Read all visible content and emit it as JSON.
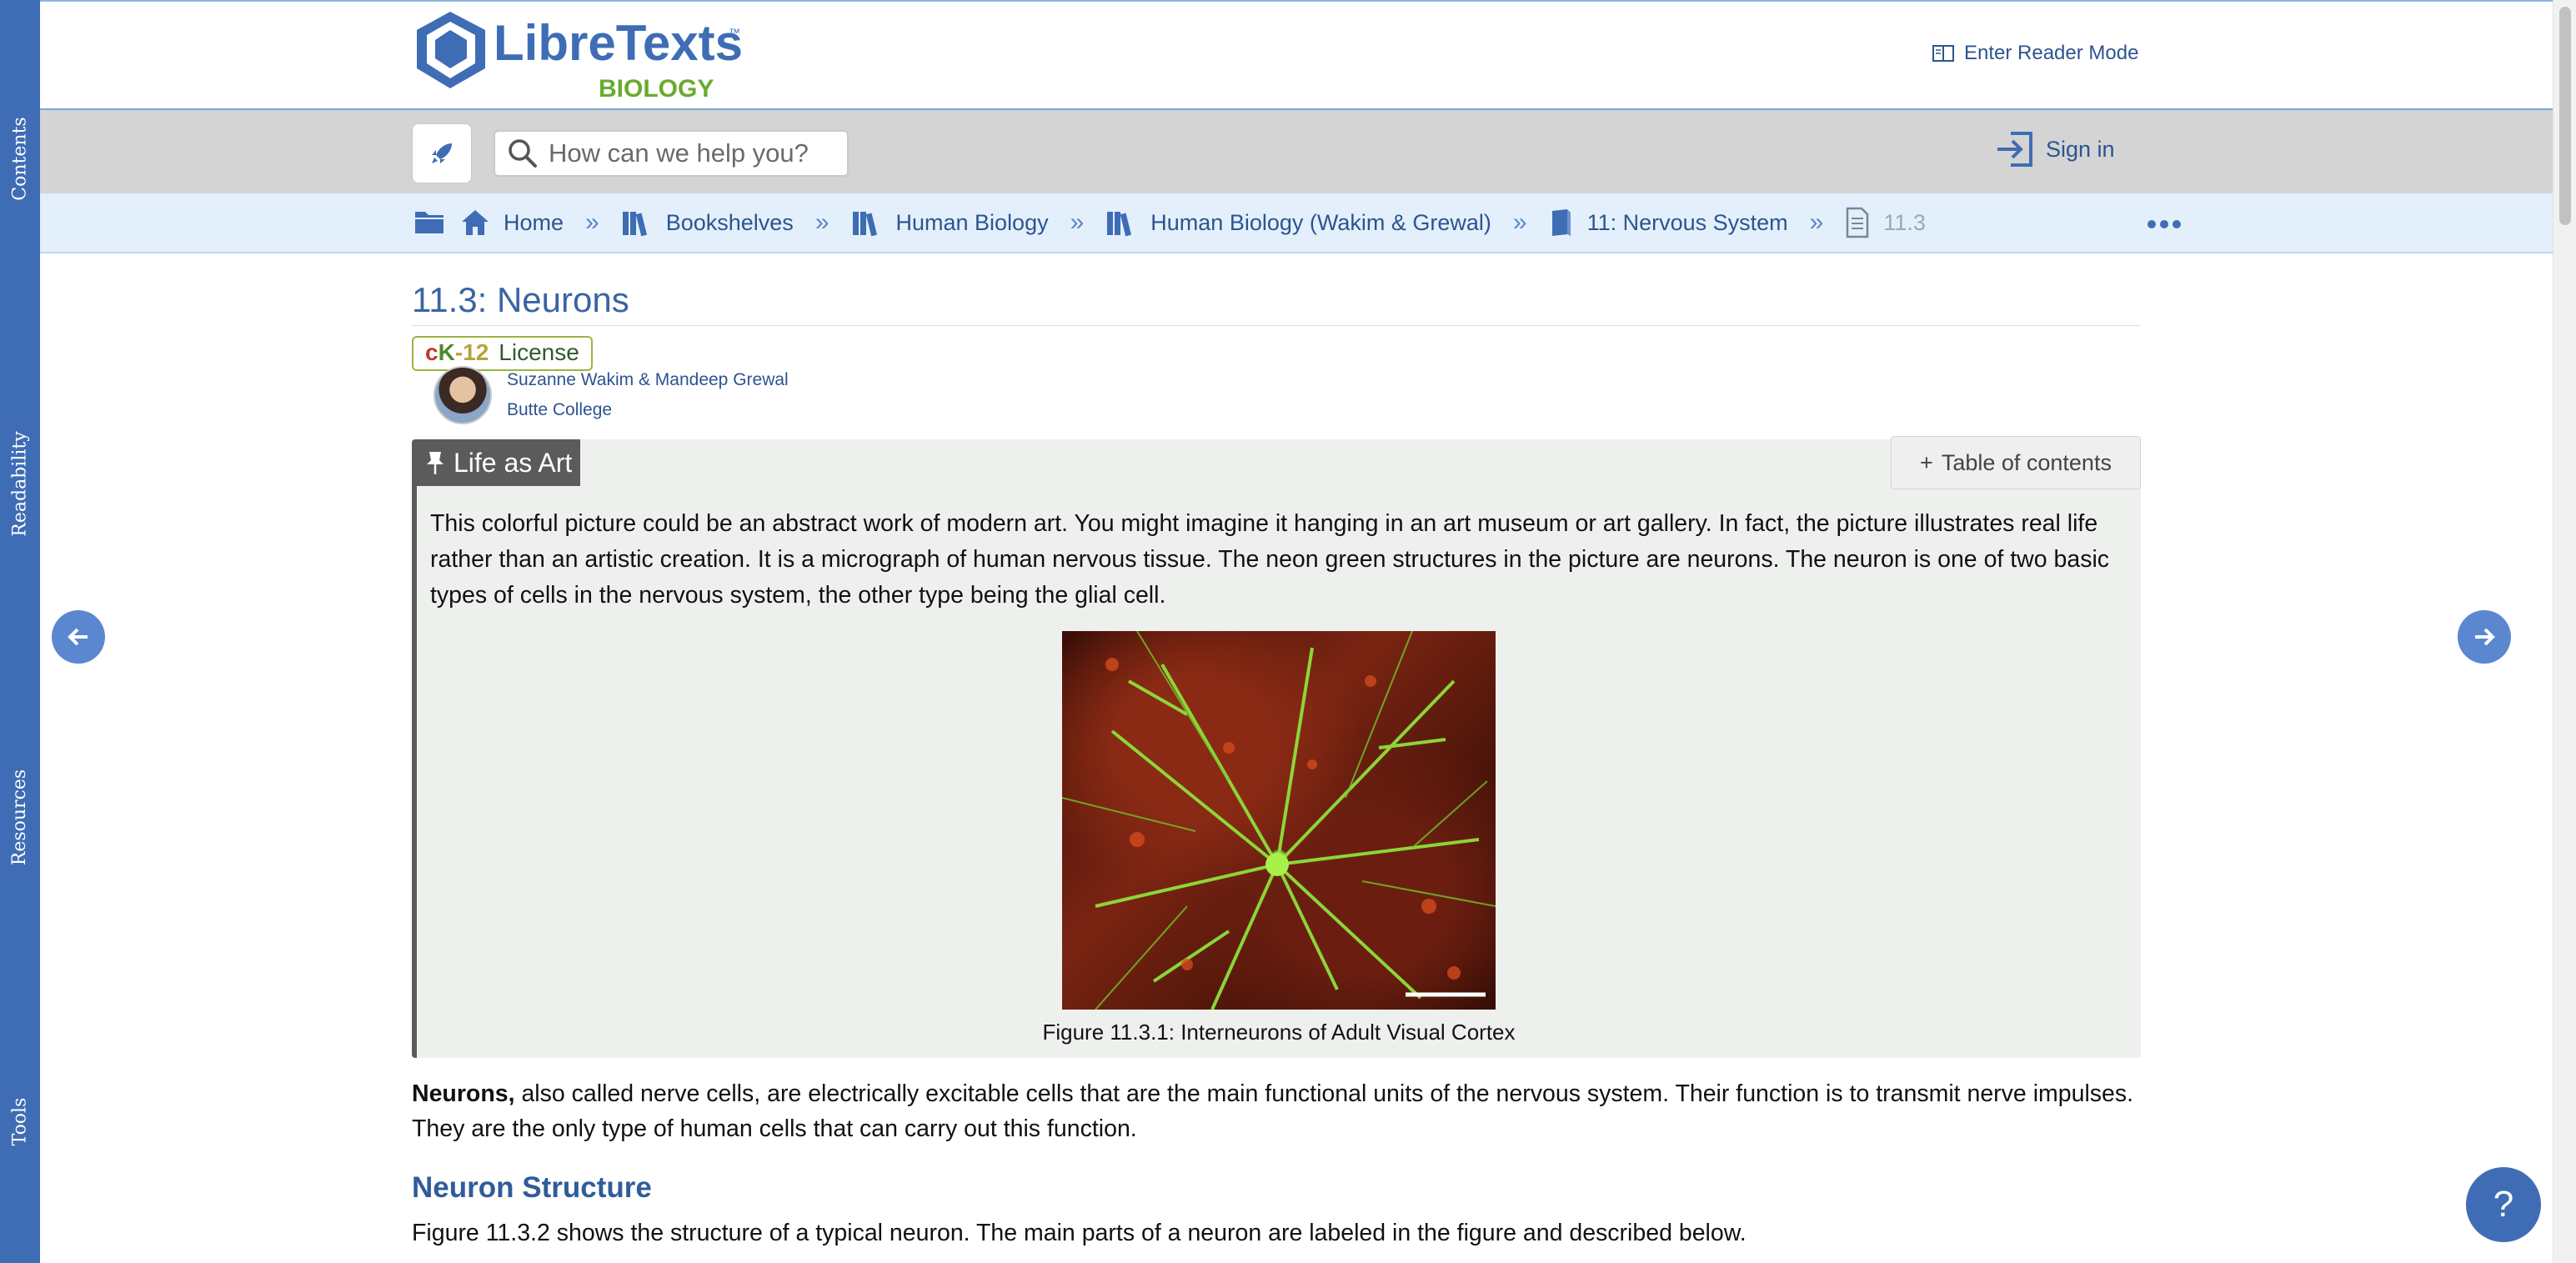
{
  "sidebar": {
    "tabs": [
      {
        "label": "Contents"
      },
      {
        "label": "Readability"
      },
      {
        "label": "Resources"
      },
      {
        "label": "Tools"
      }
    ]
  },
  "header": {
    "logo_text": "LibreTexts",
    "logo_sub": "BIOLOGY",
    "logo_tm": "™",
    "reader_mode": "Enter Reader Mode"
  },
  "toolbar": {
    "search_placeholder": "How can we help you?",
    "sign_in": "Sign in"
  },
  "breadcrumb": {
    "items": [
      {
        "label": "Home",
        "icon": "home-icon"
      },
      {
        "label": "Bookshelves",
        "icon": "books-icon"
      },
      {
        "label": "Human Biology",
        "icon": "books-icon"
      },
      {
        "label": "Human Biology (Wakim & Grewal)",
        "icon": "books-icon"
      },
      {
        "label": "11: Nervous System",
        "icon": "book-icon"
      },
      {
        "label": "11.3",
        "icon": "document-icon"
      }
    ],
    "separator": "»"
  },
  "page": {
    "title": "11.3: Neurons",
    "license": {
      "ck_c": "c",
      "ck_k": "K",
      "ck_num": "-12",
      "label": "License"
    },
    "author": "Suzanne Wakim & Mandeep Grewal",
    "institution": "Butte College"
  },
  "callout": {
    "tag": "Life as Art",
    "toc_label": "Table of contents",
    "toc_prefix": "+",
    "text": "This colorful picture could be an abstract work of modern art. You might imagine it hanging in an art museum or art gallery. In fact, the picture illustrates real life rather than an artistic creation. It is a micrograph of human nervous tissue. The neon green structures in the picture are neurons. The neuron is one of two basic types of cells in the nervous system, the other type being the glial cell.",
    "figure_caption": "Figure 11.3.1: Interneurons of Adult Visual Cortex"
  },
  "body": {
    "para1_bold": "Neurons,",
    "para1_rest": " also called nerve cells, are electrically excitable cells that are the main functional units of the nervous system. Their function is to transmit nerve impulses. They are the only type of human cells that can carry out this function.",
    "heading": "Neuron Structure",
    "para2": "Figure 11.3.2 shows the structure of a typical neuron. The main parts of a neuron are labeled in the figure and described below."
  },
  "help": {
    "label": "?"
  },
  "colors": {
    "brand_blue": "#3f6db5",
    "link_blue": "#2c5490",
    "logo_green": "#6aaa2e",
    "callout_bg": "#eef0ee"
  }
}
